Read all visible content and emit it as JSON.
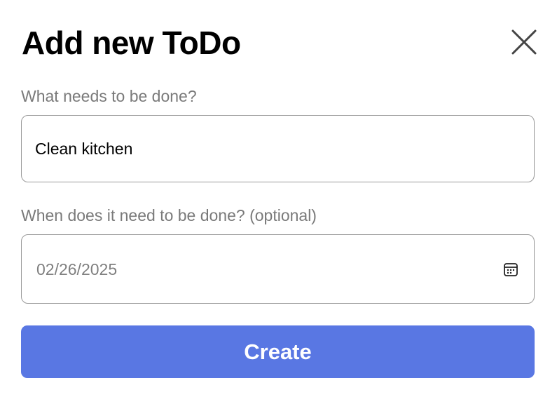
{
  "dialog": {
    "title": "Add new ToDo",
    "close_icon": "close-icon"
  },
  "task": {
    "label": "What needs to be done?",
    "value": "Clean kitchen"
  },
  "due_date": {
    "label": "When does it need to be done? (optional)",
    "value": "02/26/2025",
    "icon": "calendar-icon"
  },
  "actions": {
    "create_label": "Create"
  },
  "colors": {
    "accent": "#5977e3",
    "label_text": "#7a7a7a",
    "border": "#9a9a9a"
  }
}
